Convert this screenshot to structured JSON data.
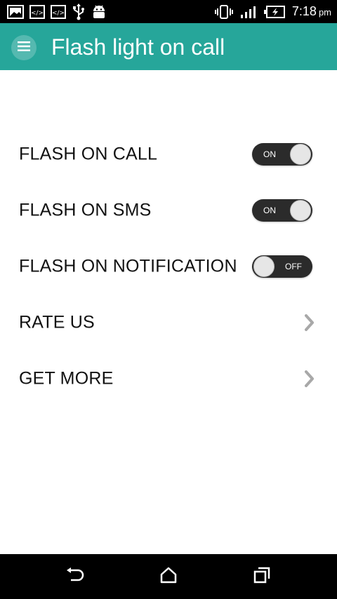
{
  "status_bar": {
    "time": "7:18",
    "ampm": "pm",
    "left_icons": [
      "image-icon",
      "code-icon",
      "code-icon",
      "usb-icon",
      "android-icon"
    ],
    "right_icons": [
      "vibrate-icon",
      "signal-icon",
      "battery-charging-icon"
    ]
  },
  "app_bar": {
    "title": "Flash light on call",
    "background": "#26a69a",
    "menu_icon": "menu-icon"
  },
  "settings": [
    {
      "label": "FLASH ON CALL",
      "control": "toggle",
      "state": "ON"
    },
    {
      "label": "FLASH ON SMS",
      "control": "toggle",
      "state": "ON"
    },
    {
      "label": "FLASH ON NOTIFICATION",
      "control": "toggle",
      "state": "OFF"
    },
    {
      "label": "RATE US",
      "control": "chevron"
    },
    {
      "label": "GET MORE",
      "control": "chevron"
    }
  ],
  "nav_bar": {
    "buttons": [
      "back-icon",
      "home-icon",
      "recents-icon"
    ]
  }
}
